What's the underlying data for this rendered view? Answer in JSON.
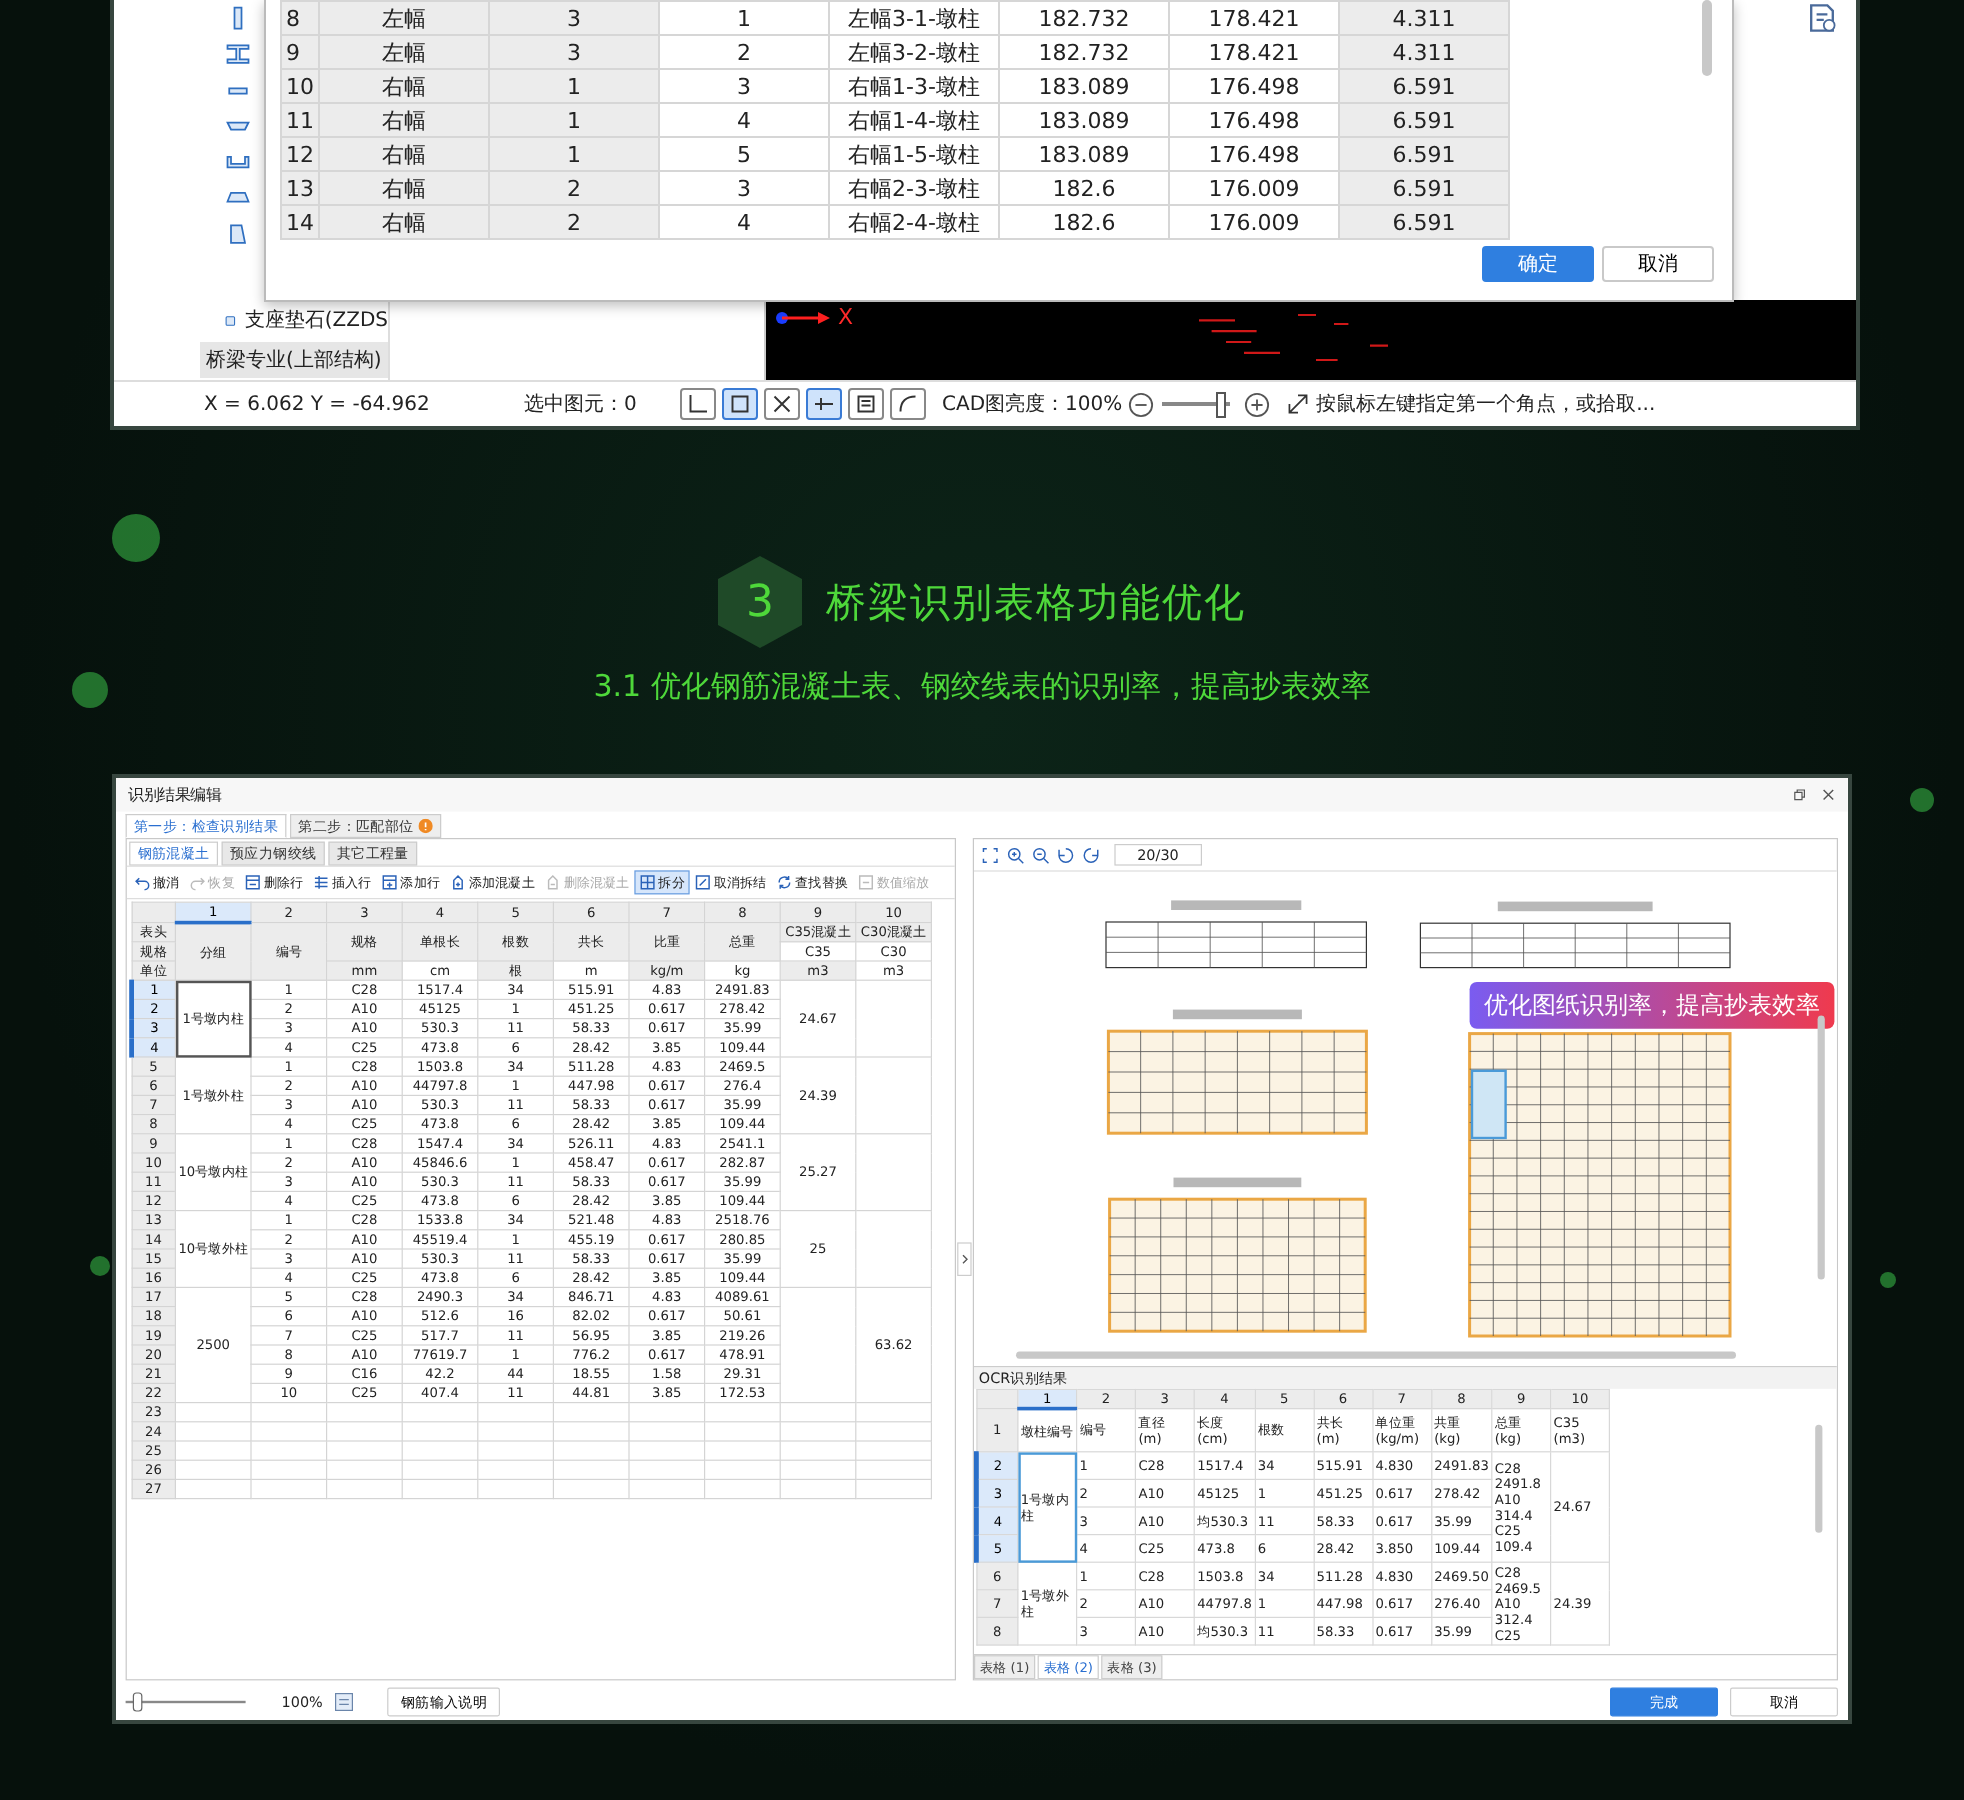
{
  "top_window": {
    "tree": [
      {
        "label": "支座垫石(ZZDS",
        "kind": "item"
      },
      {
        "label": "桥梁专业(上部结构)",
        "kind": "category"
      }
    ],
    "dialog": {
      "rows": [
        {
          "cells": [
            "8",
            "左幅",
            "3",
            "1",
            "左幅3-1-墩柱",
            "182.732",
            "178.421",
            "4.311"
          ]
        },
        {
          "cells": [
            "9",
            "左幅",
            "3",
            "2",
            "左幅3-2-墩柱",
            "182.732",
            "178.421",
            "4.311"
          ]
        },
        {
          "cells": [
            "10",
            "右幅",
            "1",
            "3",
            "右幅1-3-墩柱",
            "183.089",
            "176.498",
            "6.591"
          ]
        },
        {
          "cells": [
            "11",
            "右幅",
            "1",
            "4",
            "右幅1-4-墩柱",
            "183.089",
            "176.498",
            "6.591"
          ]
        },
        {
          "cells": [
            "12",
            "右幅",
            "1",
            "5",
            "右幅1-5-墩柱",
            "183.089",
            "176.498",
            "6.591"
          ]
        },
        {
          "cells": [
            "13",
            "右幅",
            "2",
            "3",
            "右幅2-3-墩柱",
            "182.6",
            "176.009",
            "6.591"
          ]
        },
        {
          "cells": [
            "14",
            "右幅",
            "2",
            "4",
            "右幅2-4-墩柱",
            "182.6",
            "176.009",
            "6.591"
          ]
        }
      ],
      "buttons": [
        {
          "label": "确定",
          "primary": true
        },
        {
          "label": "取消",
          "primary": false
        }
      ]
    },
    "axis_label": "X",
    "status": {
      "coords": "X = 6.062 Y = -64.962",
      "selection": "选中图元：0",
      "tools": [
        {
          "selected": false
        },
        {
          "selected": true
        },
        {
          "selected": false
        },
        {
          "selected": true
        },
        {
          "selected": false
        },
        {
          "selected": false
        }
      ],
      "brightness_label": "CAD图亮度：100%",
      "brightness": {
        "level": 0.85
      },
      "hint": "按鼠标左键指定第一个角点，或拾取..."
    }
  },
  "section": {
    "number": "3",
    "title": "桥梁识别表格功能优化",
    "subtitle": "3.1 优化钢筋混凝土表、钢绞线表的识别率，提高抄表效率"
  },
  "result_window": {
    "title": "识别结果编辑",
    "steps": [
      {
        "label": "第一步：检查识别结果",
        "selected": true,
        "alert": false
      },
      {
        "label": "第二步：匹配部位",
        "selected": false,
        "alert": true
      }
    ],
    "subtabs": [
      {
        "label": "钢筋混凝土",
        "selected": true
      },
      {
        "label": "预应力钢绞线",
        "selected": false
      },
      {
        "label": "其它工程量",
        "selected": false
      }
    ],
    "toolbar": [
      {
        "label": "撤消",
        "disabled": false,
        "selected": false
      },
      {
        "label": "恢复",
        "disabled": true,
        "selected": false
      },
      {
        "label": "删除行",
        "disabled": false,
        "selected": false
      },
      {
        "label": "插入行",
        "disabled": false,
        "selected": false
      },
      {
        "label": "添加行",
        "disabled": false,
        "selected": false
      },
      {
        "label": "添加混凝土",
        "disabled": false,
        "selected": false
      },
      {
        "label": "删除混凝土",
        "disabled": true,
        "selected": false
      },
      {
        "label": "拆分",
        "disabled": false,
        "selected": true
      },
      {
        "label": "取消拆结",
        "disabled": false,
        "selected": false
      },
      {
        "label": "查找替换",
        "disabled": false,
        "selected": false
      },
      {
        "label": "数值缩放",
        "disabled": true,
        "selected": false
      }
    ],
    "table": {
      "columns": [
        {
          "label": "1",
          "selected": true
        },
        {
          "label": "2",
          "selected": false
        },
        {
          "label": "3",
          "selected": false
        },
        {
          "label": "4",
          "selected": false
        },
        {
          "label": "5",
          "selected": false
        },
        {
          "label": "6",
          "selected": false
        },
        {
          "label": "7",
          "selected": false
        },
        {
          "label": "8",
          "selected": false
        },
        {
          "label": "9",
          "selected": false
        },
        {
          "label": "10",
          "selected": false
        }
      ],
      "row_labels": [
        "表头",
        "规格",
        "单位"
      ],
      "headers": [
        "分组",
        "编号",
        "规格",
        "单根长",
        "根数",
        "共长",
        "比重",
        "总重",
        "C35混凝土",
        "C30混凝土"
      ],
      "specs": [
        "C35",
        "C30"
      ],
      "units": [
        "mm",
        "cm",
        "根",
        "m",
        "kg/m",
        "kg",
        "m3",
        "m3"
      ],
      "groups": [
        {
          "name": "1号墩内柱",
          "c35": "24.67",
          "items": [
            {
              "n": "1",
              "selected": true,
              "cells": [
                "1",
                "C28",
                "1517.4",
                "34",
                "515.91",
                "4.83",
                "2491.83"
              ]
            },
            {
              "n": "2",
              "selected": true,
              "cells": [
                "2",
                "A10",
                "45125",
                "1",
                "451.25",
                "0.617",
                "278.42"
              ]
            },
            {
              "n": "3",
              "selected": true,
              "cells": [
                "3",
                "A10",
                "530.3",
                "11",
                "58.33",
                "0.617",
                "35.99"
              ]
            },
            {
              "n": "4",
              "selected": true,
              "cells": [
                "4",
                "C25",
                "473.8",
                "6",
                "28.42",
                "3.85",
                "109.44"
              ]
            }
          ]
        },
        {
          "name": "1号墩外柱",
          "c35": "24.39",
          "items": [
            {
              "n": "5",
              "selected": false,
              "cells": [
                "1",
                "C28",
                "1503.8",
                "34",
                "511.28",
                "4.83",
                "2469.5"
              ]
            },
            {
              "n": "6",
              "selected": false,
              "cells": [
                "2",
                "A10",
                "44797.8",
                "1",
                "447.98",
                "0.617",
                "276.4"
              ]
            },
            {
              "n": "7",
              "selected": false,
              "cells": [
                "3",
                "A10",
                "530.3",
                "11",
                "58.33",
                "0.617",
                "35.99"
              ]
            },
            {
              "n": "8",
              "selected": false,
              "cells": [
                "4",
                "C25",
                "473.8",
                "6",
                "28.42",
                "3.85",
                "109.44"
              ]
            }
          ]
        },
        {
          "name": "10号墩内柱",
          "c35": "25.27",
          "items": [
            {
              "n": "9",
              "selected": false,
              "cells": [
                "1",
                "C28",
                "1547.4",
                "34",
                "526.11",
                "4.83",
                "2541.1"
              ]
            },
            {
              "n": "10",
              "selected": false,
              "cells": [
                "2",
                "A10",
                "45846.6",
                "1",
                "458.47",
                "0.617",
                "282.87"
              ]
            },
            {
              "n": "11",
              "selected": false,
              "cells": [
                "3",
                "A10",
                "530.3",
                "11",
                "58.33",
                "0.617",
                "35.99"
              ]
            },
            {
              "n": "12",
              "selected": false,
              "cells": [
                "4",
                "C25",
                "473.8",
                "6",
                "28.42",
                "3.85",
                "109.44"
              ]
            }
          ]
        },
        {
          "name": "10号墩外柱",
          "c35": "25",
          "items": [
            {
              "n": "13",
              "selected": false,
              "cells": [
                "1",
                "C28",
                "1533.8",
                "34",
                "521.48",
                "4.83",
                "2518.76"
              ]
            },
            {
              "n": "14",
              "selected": false,
              "cells": [
                "2",
                "A10",
                "45519.4",
                "1",
                "455.19",
                "0.617",
                "280.85"
              ]
            },
            {
              "n": "15",
              "selected": false,
              "cells": [
                "3",
                "A10",
                "530.3",
                "11",
                "58.33",
                "0.617",
                "35.99"
              ]
            },
            {
              "n": "16",
              "selected": false,
              "cells": [
                "4",
                "C25",
                "473.8",
                "6",
                "28.42",
                "3.85",
                "109.44"
              ]
            }
          ]
        },
        {
          "name": "2500",
          "c30": "63.62",
          "items": [
            {
              "n": "17",
              "selected": false,
              "cells": [
                "5",
                "C28",
                "2490.3",
                "34",
                "846.71",
                "4.83",
                "4089.61"
              ]
            },
            {
              "n": "18",
              "selected": false,
              "cells": [
                "6",
                "A10",
                "512.6",
                "16",
                "82.02",
                "0.617",
                "50.61"
              ]
            },
            {
              "n": "19",
              "selected": false,
              "cells": [
                "7",
                "C25",
                "517.7",
                "11",
                "56.95",
                "3.85",
                "219.26"
              ]
            },
            {
              "n": "20",
              "selected": false,
              "cells": [
                "8",
                "A10",
                "77619.7",
                "1",
                "776.2",
                "0.617",
                "478.91"
              ]
            },
            {
              "n": "21",
              "selected": false,
              "cells": [
                "9",
                "C16",
                "42.2",
                "44",
                "18.55",
                "1.58",
                "29.31"
              ]
            },
            {
              "n": "22",
              "selected": false,
              "cells": [
                "10",
                "C25",
                "407.4",
                "11",
                "44.81",
                "3.85",
                "172.53"
              ]
            }
          ]
        }
      ],
      "empty_rows": [
        "23",
        "24",
        "25",
        "26",
        "27"
      ]
    },
    "zoom": {
      "level": 0.1,
      "label": "100%"
    },
    "help_button": "钢筋输入说明",
    "page": "20/30",
    "callout": "优化图纸识别率，提高抄表效率",
    "ocr": {
      "title": "OCR识别结果",
      "columns": [
        {
          "label": "1",
          "selected": true
        },
        {
          "label": "2",
          "selected": false
        },
        {
          "label": "3",
          "selected": false
        },
        {
          "label": "4",
          "selected": false
        },
        {
          "label": "5",
          "selected": false
        },
        {
          "label": "6",
          "selected": false
        },
        {
          "label": "7",
          "selected": false
        },
        {
          "label": "8",
          "selected": false
        },
        {
          "label": "9",
          "selected": false
        },
        {
          "label": "10",
          "selected": false
        }
      ],
      "header_row": "1",
      "headers": [
        "墩柱编号",
        "编号",
        "直径\n(m)",
        "长度\n(cm)",
        "根数",
        "共长\n(m)",
        "单位重\n(kg/m)",
        "共重\n(kg)",
        "总重\n(kg)",
        "C35\n(m3)"
      ],
      "groups": [
        {
          "name": "1号墩内柱",
          "total": "C28 2491.8 A10 314.4 C25 109.4",
          "c35": "24.67",
          "items": [
            {
              "n": "2",
              "selected": true,
              "cells": [
                "1",
                "C28",
                "1517.4",
                "34",
                "515.91",
                "4.830",
                "2491.83"
              ]
            },
            {
              "n": "3",
              "selected": true,
              "cells": [
                "2",
                "A10",
                "45125",
                "1",
                "451.25",
                "0.617",
                "278.42"
              ]
            },
            {
              "n": "4",
              "selected": true,
              "cells": [
                "3",
                "A10",
                "均530.3",
                "11",
                "58.33",
                "0.617",
                "35.99"
              ]
            },
            {
              "n": "5",
              "selected": true,
              "cells": [
                "4",
                "C25",
                "473.8",
                "6",
                "28.42",
                "3.850",
                "109.44"
              ]
            }
          ]
        },
        {
          "name": "1号墩外柱",
          "total": "C28 2469.5 A10 312.4 C25",
          "c35": "24.39",
          "items": [
            {
              "n": "6",
              "selected": false,
              "cells": [
                "1",
                "C28",
                "1503.8",
                "34",
                "511.28",
                "4.830",
                "2469.50"
              ]
            },
            {
              "n": "7",
              "selected": false,
              "cells": [
                "2",
                "A10",
                "44797.8",
                "1",
                "447.98",
                "0.617",
                "276.40"
              ]
            },
            {
              "n": "8",
              "selected": false,
              "cells": [
                "3",
                "A10",
                "均530.3",
                "11",
                "58.33",
                "0.617",
                "35.99"
              ]
            }
          ]
        }
      ],
      "sheets": [
        {
          "label": "表格 (1)",
          "selected": false
        },
        {
          "label": "表格 (2)",
          "selected": true
        },
        {
          "label": "表格 (3)",
          "selected": false
        }
      ]
    },
    "buttons": [
      {
        "label": "完成",
        "primary": true
      },
      {
        "label": "取消",
        "primary": false
      }
    ]
  }
}
